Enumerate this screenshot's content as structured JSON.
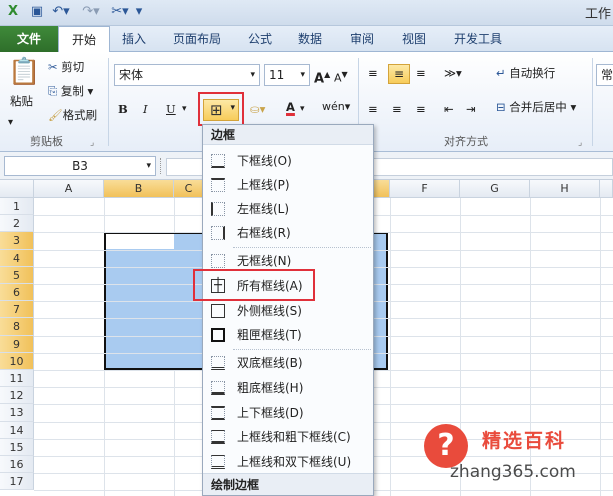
{
  "app": {
    "title": "工作"
  },
  "tabs": [
    "文件",
    "开始",
    "插入",
    "页面布局",
    "公式",
    "数据",
    "审阅",
    "视图",
    "开发工具"
  ],
  "clipboard": {
    "paste": "粘贴",
    "cut": "剪切",
    "copy": "复制",
    "format_painter": "格式刷",
    "label": "剪贴板"
  },
  "font": {
    "name": "宋体",
    "size": "11",
    "bold": "B",
    "italic": "I",
    "underline": "U"
  },
  "alignment": {
    "wrap": "自动换行",
    "merge": "合并后居中",
    "label": "对齐方式",
    "number_format": "常"
  },
  "name_box": "B3",
  "columns": [
    "A",
    "B",
    "C",
    "F",
    "G",
    "H"
  ],
  "rows": [
    "1",
    "2",
    "3",
    "4",
    "5",
    "6",
    "7",
    "8",
    "9",
    "10",
    "11",
    "12",
    "13",
    "14",
    "15",
    "16",
    "17"
  ],
  "menu": {
    "header": "边框",
    "items": [
      "下框线(O)",
      "上框线(P)",
      "左框线(L)",
      "右框线(R)",
      "无框线(N)",
      "所有框线(A)",
      "外侧框线(S)",
      "粗匣框线(T)",
      "双底框线(B)",
      "粗底框线(H)",
      "上下框线(D)",
      "上框线和粗下框线(C)",
      "上框线和双下框线(U)"
    ],
    "footer": "绘制边框"
  },
  "watermark": {
    "brand": "精选百科",
    "url": "zhang365.com"
  },
  "colors": {
    "file_tab": "#2e6e2a",
    "highlight": "#e0303a",
    "selection": "#a9cbf0",
    "brand": "#e94b3c"
  }
}
